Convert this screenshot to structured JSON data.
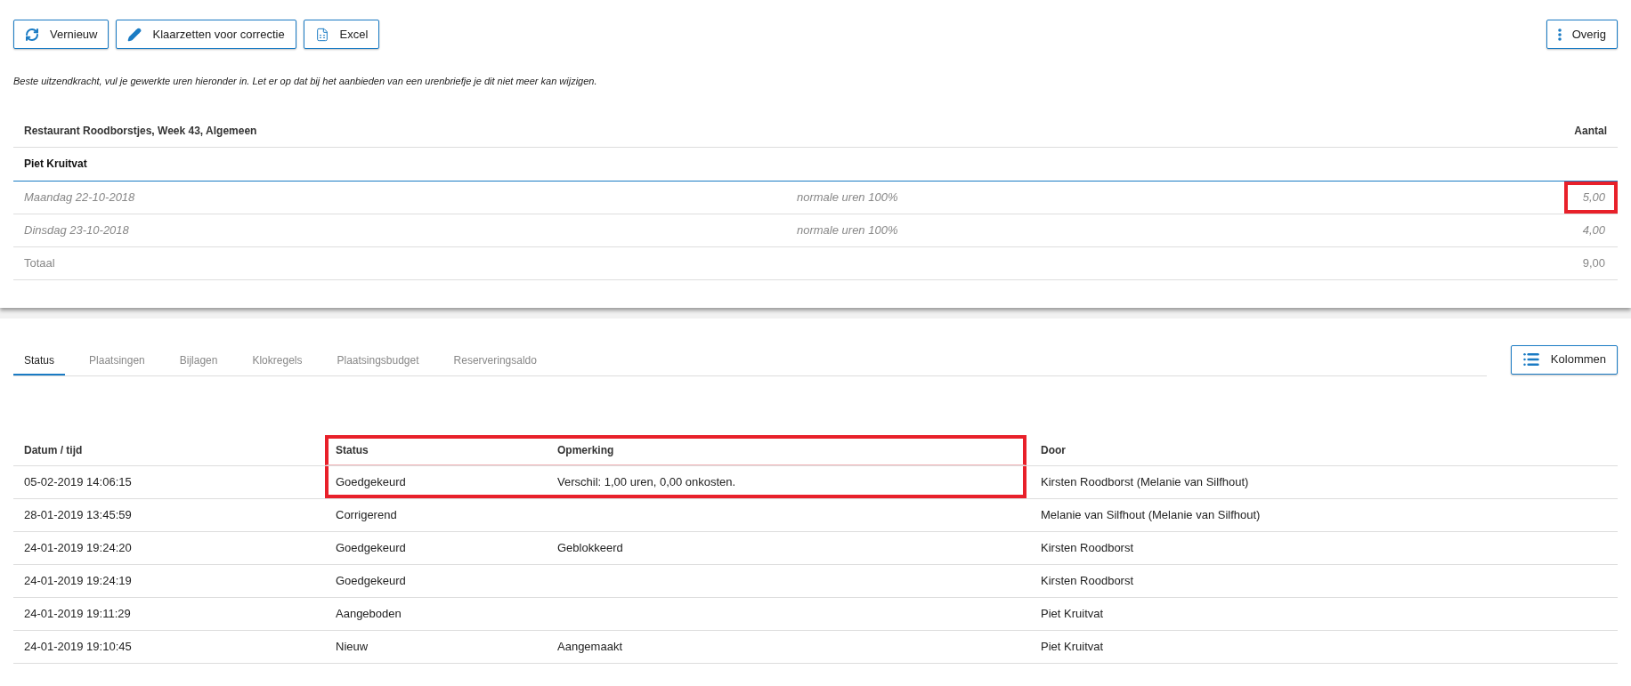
{
  "toolbar": {
    "buttons": [
      {
        "kind": "refresh",
        "label": "Vernieuw"
      },
      {
        "kind": "edit",
        "label": "Klaarzetten voor correctie"
      },
      {
        "kind": "excel",
        "label": "Excel"
      }
    ],
    "more": {
      "label": "Overig"
    }
  },
  "notice": "Beste uitzendkracht, vul je gewerkte uren hieronder in. Let er op dat bij het aanbieden van een urenbriefje je dit niet meer kan wijzigen.",
  "hours": {
    "title": "Restaurant Roodborstjes, Week 43, Algemeen",
    "amount_header": "Aantal",
    "person": "Piet Kruitvat",
    "rows": [
      {
        "kind": "day",
        "date": "Maandag 22-10-2018",
        "type": "normale uren 100%",
        "amount": "5,00",
        "highlighted": true
      },
      {
        "kind": "day",
        "date": "Dinsdag 23-10-2018",
        "type": "normale uren 100%",
        "amount": "4,00",
        "highlighted": false
      },
      {
        "kind": "total",
        "date": "Totaal",
        "amount": "9,00",
        "highlighted": false
      }
    ]
  },
  "tabs": [
    {
      "label": "Status",
      "selected": true
    },
    {
      "label": "Plaatsingen",
      "selected": false
    },
    {
      "label": "Bijlagen",
      "selected": false
    },
    {
      "label": "Klokregels",
      "selected": false
    },
    {
      "label": "Plaatsingsbudget",
      "selected": false
    },
    {
      "label": "Reserveringsaldo",
      "selected": false
    }
  ],
  "columns_button": {
    "label": "Kolommen"
  },
  "history": {
    "columns": [
      {
        "label": "Datum / tijd",
        "highlighted": false
      },
      {
        "label": "Status",
        "highlighted": true
      },
      {
        "label": "Opmerking",
        "highlighted": true
      },
      {
        "label": "Door",
        "highlighted": false
      }
    ],
    "rows": [
      {
        "cells": [
          {
            "text": "05-02-2019 14:06:15",
            "highlighted": false
          },
          {
            "text": "Goedgekeurd",
            "highlighted": true
          },
          {
            "text": "Verschil: 1,00 uren, 0,00 onkosten.",
            "highlighted": true
          },
          {
            "text": "Kirsten Roodborst (Melanie van Silfhout)",
            "highlighted": false
          }
        ]
      },
      {
        "cells": [
          {
            "text": "28-01-2019 13:45:59",
            "highlighted": false
          },
          {
            "text": "Corrigerend",
            "highlighted": false
          },
          {
            "highlighted": false
          },
          {
            "text": "Melanie van Silfhout (Melanie van Silfhout)",
            "highlighted": false
          }
        ]
      },
      {
        "cells": [
          {
            "text": "24-01-2019 19:24:20",
            "highlighted": false
          },
          {
            "text": "Goedgekeurd",
            "highlighted": false
          },
          {
            "text": "Geblokkeerd",
            "highlighted": false
          },
          {
            "text": "Kirsten Roodborst",
            "highlighted": false
          }
        ]
      },
      {
        "cells": [
          {
            "text": "24-01-2019 19:24:19",
            "highlighted": false
          },
          {
            "text": "Goedgekeurd",
            "highlighted": false
          },
          {
            "highlighted": false
          },
          {
            "text": "Kirsten Roodborst",
            "highlighted": false
          }
        ]
      },
      {
        "cells": [
          {
            "text": "24-01-2019 19:11:29",
            "highlighted": false
          },
          {
            "text": "Aangeboden",
            "highlighted": false
          },
          {
            "highlighted": false
          },
          {
            "text": "Piet Kruitvat",
            "highlighted": false
          }
        ]
      },
      {
        "cells": [
          {
            "text": "24-01-2019 19:10:45",
            "highlighted": false
          },
          {
            "text": "Nieuw",
            "highlighted": false
          },
          {
            "text": "Aangemaakt",
            "highlighted": false
          },
          {
            "text": "Piet Kruitvat",
            "highlighted": false
          }
        ]
      }
    ]
  }
}
